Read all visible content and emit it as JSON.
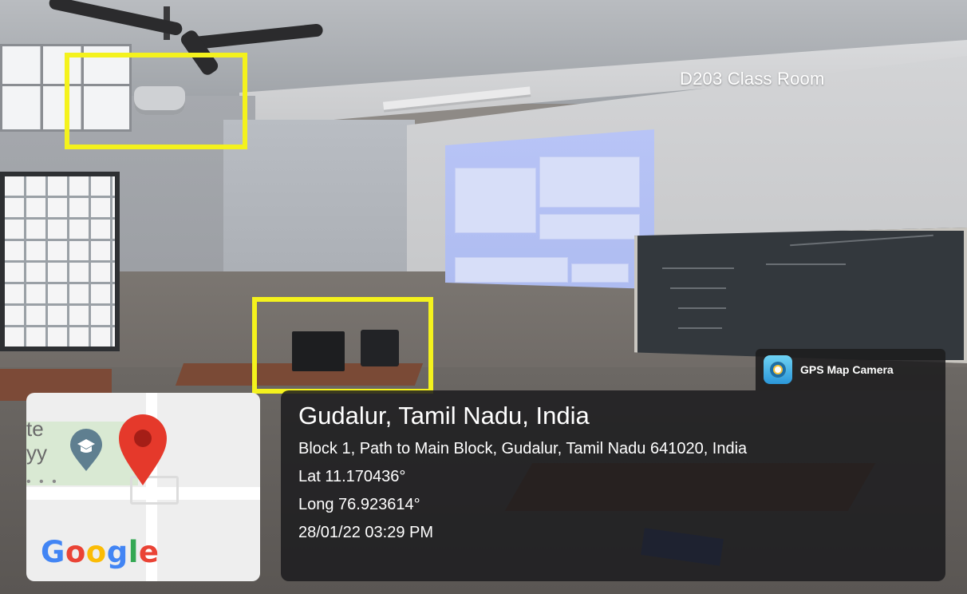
{
  "photo": {
    "room_label": "D203 Class Room"
  },
  "badge": {
    "app_name": "GPS Map Camera",
    "app_icon": "gps-map-camera-icon"
  },
  "map": {
    "fragment": "te\nyy",
    "dots": "• • •",
    "education_icon": "education-pin-icon",
    "location_icon": "location-pin-icon",
    "logo": [
      "G",
      "o",
      "o",
      "g",
      "l",
      "e"
    ]
  },
  "location": {
    "title": "Gudalur, Tamil Nadu, India",
    "address": "Block 1, Path to Main Block, Gudalur, Tamil Nadu 641020, India",
    "lat": "Lat 11.170436°",
    "long": "Long 76.923614°",
    "datetime": "28/01/22 03:29 PM"
  },
  "colors": {
    "highlight": "#f4f21d",
    "overlay": "#1c1c1e",
    "pin": "#e5392b"
  }
}
